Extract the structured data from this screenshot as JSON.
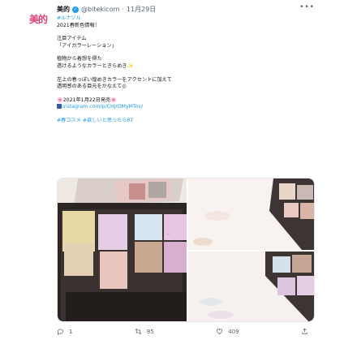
{
  "tweet": {
    "avatar_text": "美的",
    "display_name": "美的",
    "handle": "@bitekicom",
    "date": "11月29日",
    "separator": "·",
    "more": "•••",
    "lines": {
      "hashtag1": "#ルナソル",
      "l2": "2021春新色情報！",
      "l3": "注目アイテム",
      "l4": "「アイカラーレーション」",
      "l5": "植物から着想を得た",
      "l6": "透けるようなカラーときらめき",
      "l7": "左上の春っぽい煌めきカラーをアクセントに加えて",
      "l8": "透明感のある目元をかなえて◎",
      "l9": "2021年1月22日発売",
      "link": "instagram.com/p/CHjrDMyMTov/",
      "hashtags": "#春コスメ #欲しいと思ったらRT"
    },
    "icons": {
      "sparkle": "✨",
      "flower": "🌸"
    },
    "actions": {
      "reply_count": "1",
      "retweet_count": "85",
      "like_count": "409"
    }
  }
}
